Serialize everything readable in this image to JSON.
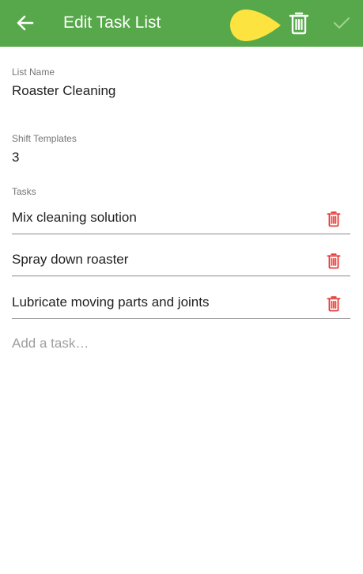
{
  "colors": {
    "appbar": "#57a84a",
    "highlight": "#fde33f",
    "delete": "#e53935",
    "text": "#212121",
    "label": "#757575",
    "placeholder": "#9e9e9e"
  },
  "header": {
    "title": "Edit Task List",
    "back_icon": "arrow-left-icon",
    "delete_icon": "trash-icon",
    "confirm_icon": "check-icon"
  },
  "form": {
    "list_name_label": "List Name",
    "list_name_value": "Roaster Cleaning",
    "shift_templates_label": "Shift Templates",
    "shift_templates_value": "3",
    "tasks_label": "Tasks",
    "tasks": [
      {
        "text": "Mix cleaning solution"
      },
      {
        "text": "Spray down roaster"
      },
      {
        "text": "Lubricate moving parts and joints"
      }
    ],
    "add_task_placeholder": "Add a task…"
  }
}
